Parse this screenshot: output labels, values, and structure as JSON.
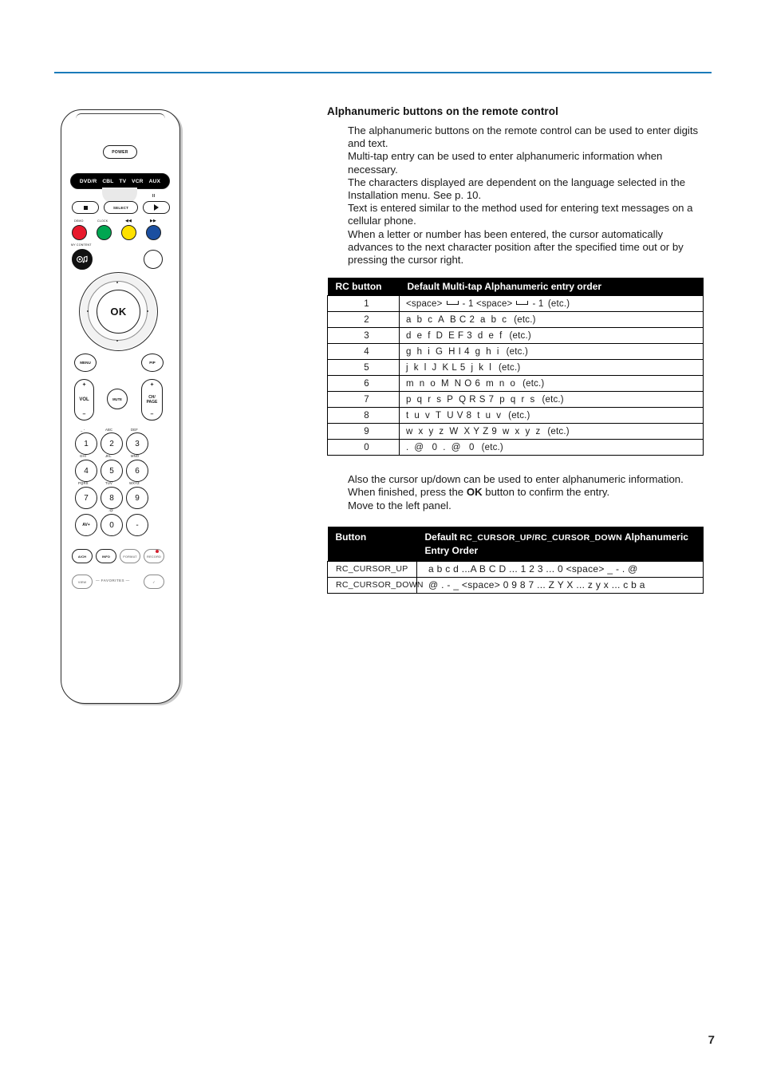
{
  "page": {
    "number": "7",
    "rule_color": "#1a7bb9"
  },
  "section": {
    "title": "Alphanumeric buttons on the remote control",
    "intro_paragraphs": [
      "The alphanumeric buttons on the remote control can be used to enter digits and text.",
      "Multi-tap entry can be used to enter alphanumeric information when necessary.",
      "The characters displayed are dependent on the language selected in the Installation menu. See p. 10.",
      "Text is entered similar to the method used for entering text messages on a cellular phone.",
      "When a letter or number has been entered, the cursor automatically advances to the next character position after the specified time out or by pressing the cursor right."
    ],
    "mid_paragraphs": [
      "Also the cursor up/down can be used to enter alphanumeric information.",
      "When finished, press the OK button to confirm the entry.",
      "Move to the left panel."
    ],
    "mid_bold_word": "OK"
  },
  "table_multitap": {
    "headers": [
      "RC button",
      "Default Multi-tap Alphanumeric entry order"
    ],
    "rows": [
      {
        "key": "1",
        "sequence": "<space> ␣ - 1 <space> ␣ - 1 (etc.)"
      },
      {
        "key": "2",
        "sequence": "a b c A B C 2 a b c (etc.)"
      },
      {
        "key": "3",
        "sequence": "d e f D E F 3 d e f (etc.)"
      },
      {
        "key": "4",
        "sequence": "g h i G H I 4 g h i (etc.)"
      },
      {
        "key": "5",
        "sequence": "j k l J K L 5 j k l (etc.)"
      },
      {
        "key": "6",
        "sequence": "m n o M N O 6 m n o (etc.)"
      },
      {
        "key": "7",
        "sequence": "p q r s P Q R S 7 p q r s (etc.)"
      },
      {
        "key": "8",
        "sequence": "t u v T U V 8 t u v (etc.)"
      },
      {
        "key": "9",
        "sequence": "w x y z W X Y Z 9 w x y z (etc.)"
      },
      {
        "key": "0",
        "sequence": ". @ 0 . @ 0 (etc.)"
      }
    ]
  },
  "table_cursor": {
    "header_col1": "Button",
    "header_col2_line1_a": "Default ",
    "header_col2_line1_b": "RC_CURSOR_UP/RC_CURSOR_DOWN",
    "header_col2_line1_c": " Alphanumeric",
    "header_col2_line2": "Entry Order",
    "rows": [
      {
        "button": "RC_CURSOR_UP",
        "sequence": "a  b  c  d  ...A B C D ... 1 2 3 ... 0 <space> _ - . @"
      },
      {
        "button": "RC_CURSOR_DOWN",
        "sequence": "@  .  -  _   <space> 0 9 8 7 ... Z Y X ... z y x ... c b a"
      }
    ]
  },
  "remote": {
    "power_label": "POWER",
    "mode_buttons": [
      "DVD/R",
      "CBL",
      "TV",
      "VCR",
      "AUX"
    ],
    "select_label": "SELECT",
    "pause_glyph": "II",
    "color_key_labels": {
      "red": "DEMO",
      "green": "CLOCK",
      "yellow": "◀◀",
      "blue": "▶▶"
    },
    "color_key_colors": {
      "red": "#e8192c",
      "green": "#00a651",
      "yellow": "#ffe100",
      "blue": "#1b4fa0"
    },
    "my_content_label": "MY CONTENT",
    "ok_label": "OK",
    "menu_label": "MENU",
    "pip_label": "PIP",
    "vol_label": "VOL",
    "mute_label": "MUTE",
    "ch_label_line1": "CH/",
    "ch_label_line2": "PAGE",
    "plus": "+",
    "minus": "–",
    "keypad": [
      {
        "digit": "1",
        "top_label": "_ -",
        "bottom_label": "GHI"
      },
      {
        "digit": "2",
        "top_label": "ABC",
        "bottom_label": "JKL"
      },
      {
        "digit": "3",
        "top_label": "DEF",
        "bottom_label": "MNO"
      },
      {
        "digit": "4",
        "top_label": "",
        "bottom_label": "PQRS"
      },
      {
        "digit": "5",
        "top_label": "",
        "bottom_label": "TUV"
      },
      {
        "digit": "6",
        "top_label": "",
        "bottom_label": "WXYZ"
      },
      {
        "digit": "7",
        "top_label": "",
        "bottom_label": ""
      },
      {
        "digit": "8",
        "top_label": "",
        "bottom_label": ".@"
      },
      {
        "digit": "9",
        "top_label": "",
        "bottom_label": ""
      },
      {
        "digit": "AV+",
        "top_label": "",
        "bottom_label": ""
      },
      {
        "digit": "0",
        "top_label": "",
        "bottom_label": ""
      },
      {
        "digit": "-",
        "top_label": "",
        "bottom_label": ""
      }
    ],
    "function_keys": [
      "A/CH",
      "INFO",
      "FORMAT",
      "RECORD"
    ],
    "view_label": "VIEW",
    "favorites_label": "—  FAVORITES  —",
    "check_label": "✓",
    "record_dot_color": "#d2202f"
  }
}
